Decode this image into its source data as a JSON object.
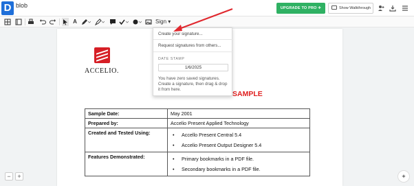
{
  "app": {
    "logo_letter": "D",
    "document_title": "blob"
  },
  "header": {
    "upgrade_label": "UPGRADE TO PRO ✈",
    "walkthrough_label": "Show Walkthrough",
    "icons": [
      "add-user-icon",
      "download-icon",
      "menu-icon"
    ]
  },
  "toolbar": {
    "tools": [
      "thumbnails-icon",
      "bookmarks-icon",
      "print-icon",
      "undo-icon",
      "redo-icon",
      "select-cursor-icon",
      "text-tool-icon",
      "pen-icon",
      "highlighter-icon",
      "comment-icon",
      "checkmark-icon",
      "shapes-icon",
      "image-icon"
    ],
    "sign_label": "Sign ▾"
  },
  "sign_dropdown": {
    "create_signature": "Create your signature...",
    "request_signatures": "Request signatures from others...",
    "date_stamp_caption": "DATE STAMP",
    "date_value": "1/6/2025",
    "help_text": "You have zero saved signatures. Create a signature, then drag & drop it from here."
  },
  "document": {
    "logo_text": "ACCELIO.",
    "heading": "PDF BOOKMARK SAMPLE",
    "table": {
      "rows": [
        {
          "label": "Sample Date:",
          "value": "May 2001"
        },
        {
          "label": "Prepared by:",
          "value": "Accelio Present Applied Technology"
        },
        {
          "label": "Created and Tested Using:",
          "items": [
            "Accello Present Central 5.4",
            "Accelio Present Output Designer 5.4"
          ]
        },
        {
          "label": "Features Demonstrated:",
          "items": [
            "Primary bookmarks in a PDF file.",
            "Secondary bookmarks in a PDF file."
          ]
        }
      ]
    }
  },
  "zoom": {
    "zoom_out": "−",
    "zoom_in": "+"
  },
  "colors": {
    "brand_blue": "#1e6fd9",
    "upgrade_green": "#2fb163",
    "heading_red": "#e02020",
    "annotation_arrow": "#e0282e"
  }
}
